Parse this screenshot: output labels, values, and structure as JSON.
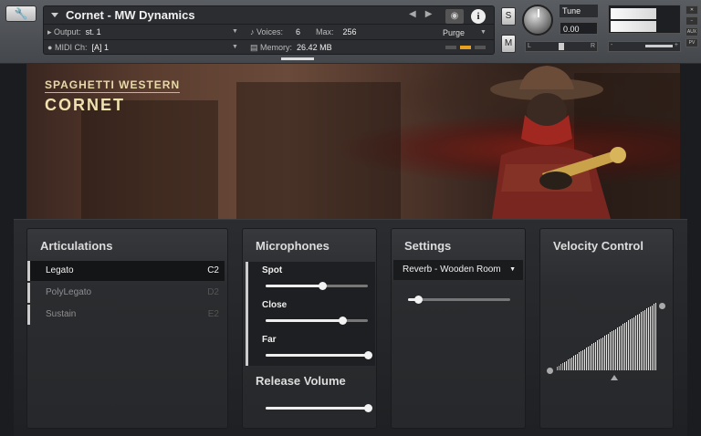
{
  "header": {
    "instrument_title": "Cornet - MW Dynamics",
    "output_label": "Output:",
    "output_value": "st. 1",
    "midi_label": "MIDI Ch:",
    "midi_value": "[A]  1",
    "voices_label": "Voices:",
    "voices_value": "6",
    "max_label": "Max:",
    "max_value": "256",
    "memory_label": "Memory:",
    "memory_value": "26.42 MB",
    "purge_label": "Purge",
    "solo_label": "S",
    "mute_label": "M",
    "tune_label": "Tune",
    "tune_value": "0.00",
    "pan_left": "L",
    "pan_right": "R",
    "vol_minus": "-",
    "vol_plus": "+",
    "side_tabs": [
      "AUX",
      "PV"
    ]
  },
  "banner": {
    "subtitle": "SPAGHETTI WESTERN",
    "title": "CORNET"
  },
  "articulations": {
    "title": "Articulations",
    "items": [
      {
        "label": "Legato",
        "key": "C2",
        "active": true
      },
      {
        "label": "PolyLegato",
        "key": "D2",
        "active": false
      },
      {
        "label": "Sustain",
        "key": "E2",
        "active": false
      }
    ]
  },
  "microphones": {
    "title": "Microphones",
    "mics": [
      {
        "label": "Spot",
        "level": 0.55
      },
      {
        "label": "Close",
        "level": 0.75
      },
      {
        "label": "Far",
        "level": 1.0
      }
    ],
    "release_title": "Release Volume",
    "release_level": 1.0
  },
  "settings": {
    "title": "Settings",
    "reverb_value": "Reverb - Wooden Room",
    "reverb_level": 0.1
  },
  "velocity": {
    "title": "Velocity Control",
    "curve": "linear-ascending"
  },
  "colors": {
    "accent_meter": "#e8a020",
    "text_active": "#f0f0f0",
    "text_inactive": "#9a9a9a"
  }
}
